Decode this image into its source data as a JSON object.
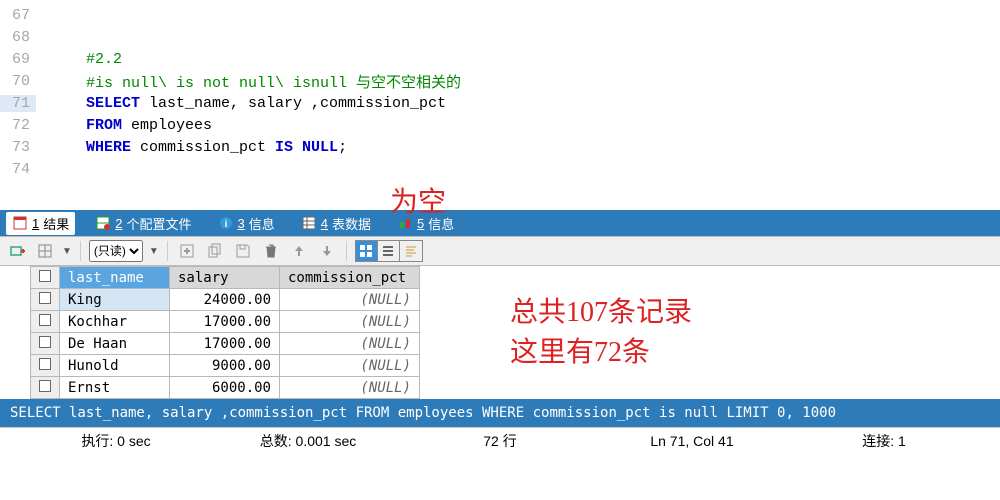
{
  "editor": {
    "lines": [
      {
        "num": "67",
        "code": ""
      },
      {
        "num": "68",
        "code": ""
      },
      {
        "num": "69",
        "code": "#2.2",
        "comment": true
      },
      {
        "num": "70",
        "code": "#is null\\ is not null\\ isnull 与空不空相关的",
        "comment": true
      },
      {
        "num": "71",
        "code_tokens": [
          {
            "t": "SELECT",
            "k": 1
          },
          {
            "t": " last_name, salary ,commission_pct"
          }
        ],
        "hl": true
      },
      {
        "num": "72",
        "code_tokens": [
          {
            "t": "FROM",
            "k": 1
          },
          {
            "t": " employees"
          }
        ]
      },
      {
        "num": "73",
        "code_tokens": [
          {
            "t": "WHERE",
            "k": 1
          },
          {
            "t": " commission_pct "
          },
          {
            "t": "IS NULL",
            "k": 1
          },
          {
            "t": ";"
          }
        ]
      },
      {
        "num": "74",
        "code": ""
      }
    ]
  },
  "annotations": {
    "top": "为空",
    "right1": "总共107条记录",
    "right2": "这里有72条"
  },
  "tabs": [
    {
      "n": "1",
      "label": "结果",
      "active": true
    },
    {
      "n": "2",
      "label": "个配置文件"
    },
    {
      "n": "3",
      "label": "信息"
    },
    {
      "n": "4",
      "label": "表数据"
    },
    {
      "n": "5",
      "label": "信息"
    }
  ],
  "toolbar": {
    "readonly": "(只读)"
  },
  "grid": {
    "headers": [
      "last_name",
      "salary",
      "commission_pct"
    ],
    "rows": [
      {
        "last_name": "King",
        "salary": "24000.00",
        "commission_pct": "(NULL)",
        "sel": true
      },
      {
        "last_name": "Kochhar",
        "salary": "17000.00",
        "commission_pct": "(NULL)"
      },
      {
        "last_name": "De Haan",
        "salary": "17000.00",
        "commission_pct": "(NULL)"
      },
      {
        "last_name": "Hunold",
        "salary": "9000.00",
        "commission_pct": "(NULL)"
      },
      {
        "last_name": "Ernst",
        "salary": "6000.00",
        "commission_pct": "(NULL)"
      }
    ]
  },
  "querybar": "SELECT last_name, salary ,commission_pct FROM employees WHERE commission_pct is null LIMIT 0, 1000",
  "status": {
    "exec_label": "执行:",
    "exec_val": "0 sec",
    "total_label": "总数:",
    "total_val": "0.001 sec",
    "rows": "72 行",
    "pos": "Ln 71, Col 41",
    "conn_label": "连接:",
    "conn_val": "1"
  }
}
